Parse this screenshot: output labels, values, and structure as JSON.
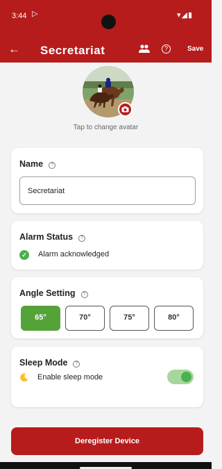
{
  "status_bar": {
    "time": "3:44",
    "play_glyph": "▷",
    "right_icons": "▾◢▮"
  },
  "app_bar": {
    "title": "Secretariat",
    "save_label": "Save",
    "back_icon": "←",
    "group_icon": "👥",
    "help_icon": "?"
  },
  "avatar": {
    "caption": "Tap to change avatar",
    "camera_icon": "camera-icon"
  },
  "name_card": {
    "title": "Name",
    "help": "?",
    "value": "Secretariat"
  },
  "alarm_card": {
    "title": "Alarm Status",
    "help": "?",
    "check": "✓",
    "status_text": "Alarm acknowledged",
    "status_color": "#4caf50"
  },
  "angle_card": {
    "title": "Angle Setting",
    "help": "?",
    "options": [
      "65°",
      "70°",
      "75°",
      "80°"
    ],
    "selected": "65°",
    "active_color": "#53a338"
  },
  "sleep_card": {
    "title": "Sleep Mode",
    "help": "?",
    "label": "Enable sleep mode",
    "enabled": true
  },
  "deregister_label": "Deregister Device",
  "colors": {
    "primary": "#b71c1c",
    "success": "#4caf50",
    "background": "#f3f3f3"
  }
}
